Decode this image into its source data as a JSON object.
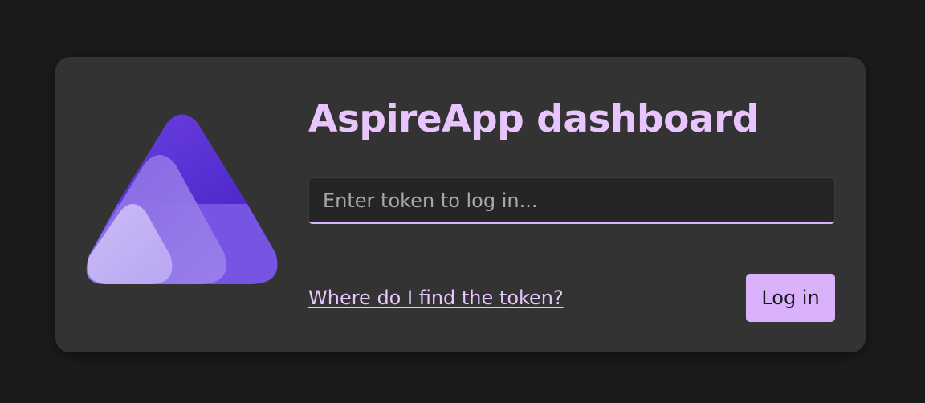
{
  "app": {
    "title": "AspireApp dashboard",
    "logo_icon": "aspire-logo-icon"
  },
  "login": {
    "token_placeholder": "Enter token to log in...",
    "token_value": "",
    "help_link_label": "Where do I find the token?",
    "login_button_label": "Log in"
  },
  "colors": {
    "page_background": "#1b1b1b",
    "card_background": "#333333",
    "accent": "#e8c6fd",
    "button_background": "#dab2fc",
    "input_background": "#252525"
  }
}
